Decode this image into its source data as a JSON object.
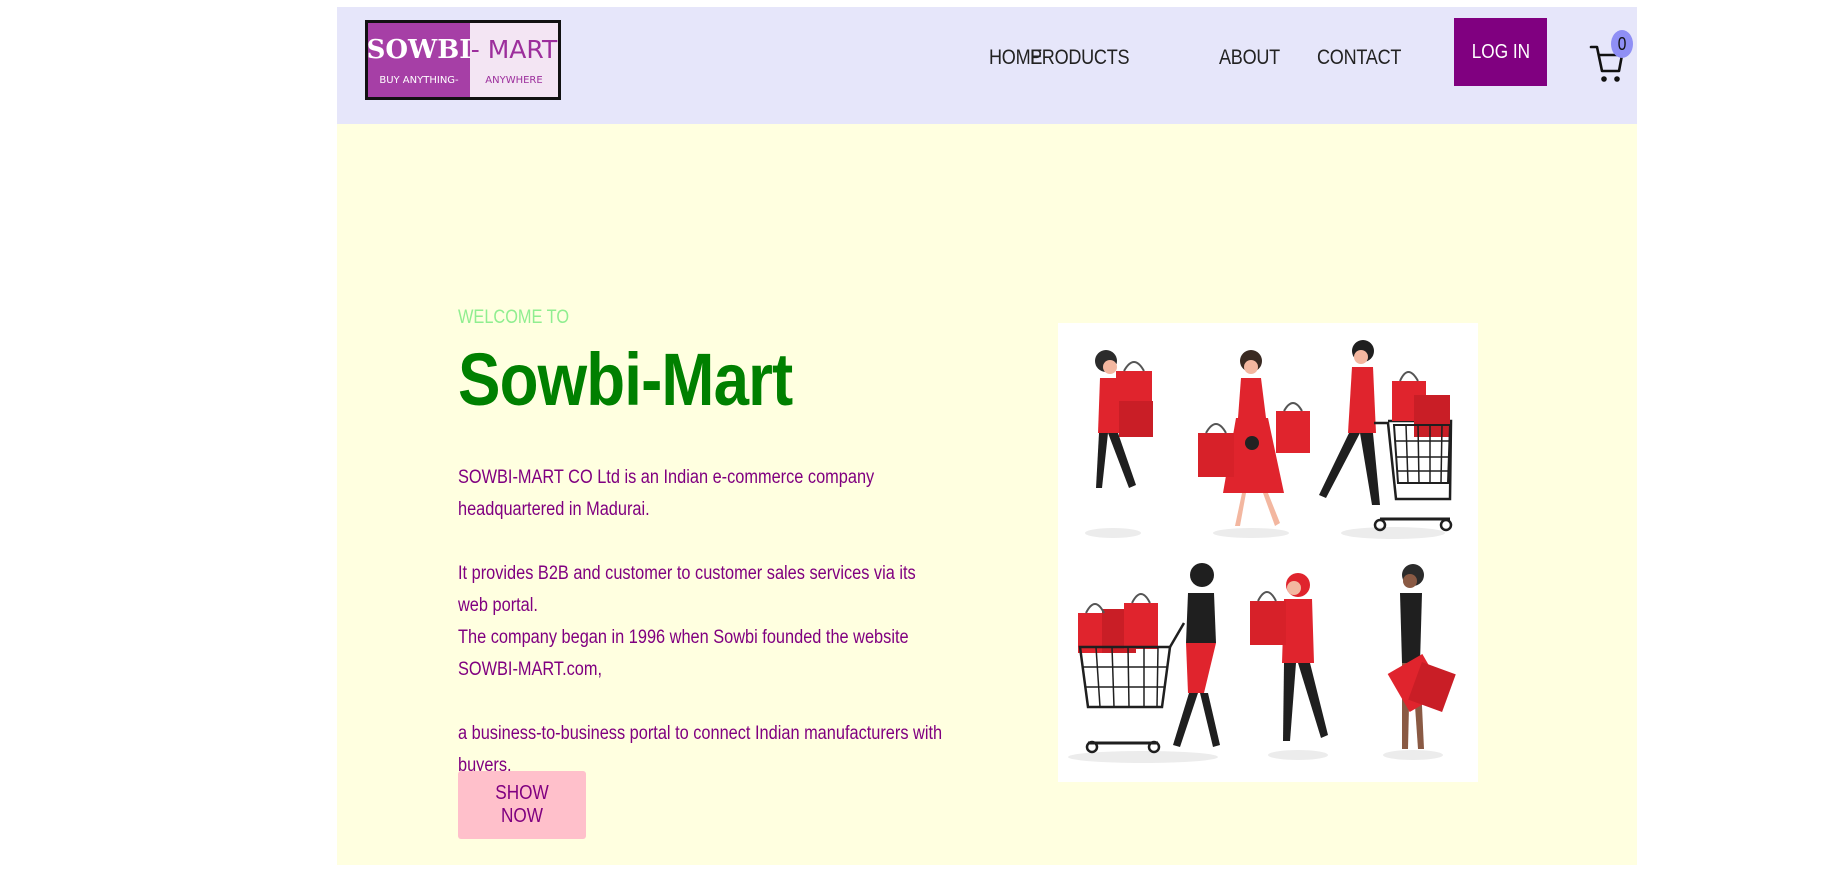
{
  "logo": {
    "left_big": "SOWBI",
    "left_small": "BUY ANYTHING-",
    "right_big": "- MART",
    "right_small": "ANYWHERE"
  },
  "nav": {
    "links": [
      {
        "label": "HOME"
      },
      {
        "label": "PRODUCTS"
      },
      {
        "label": "ABOUT"
      },
      {
        "label": "CONTACT"
      }
    ],
    "login_label": "LOG IN",
    "cart_count": "0"
  },
  "hero": {
    "welcome": "WELCOME TO",
    "title": "Sowbi-Mart",
    "paragraphs": [
      "SOWBI-MART CO Ltd is an Indian e-commerce company headquartered in Madurai.",
      "It provides B2B and customer to customer sales services via its web portal.",
      "The company began in 1996 when Sowbi founded the website SOWBI-MART.com,",
      "a business-to-business portal to connect Indian manufacturers with buyers."
    ],
    "shop_button": "SHOW NOW"
  },
  "colors": {
    "navbar_bg": "#e6e6fa",
    "page_bg": "#ffffe0",
    "accent_purple": "#800080",
    "title_green": "#008000",
    "welcome_green": "#90ee90",
    "button_pink": "#ffc0cb",
    "badge_blue": "#8f8ff5",
    "illustration_red": "#e0242d"
  },
  "icons": {
    "cart": "shopping-cart-icon"
  }
}
